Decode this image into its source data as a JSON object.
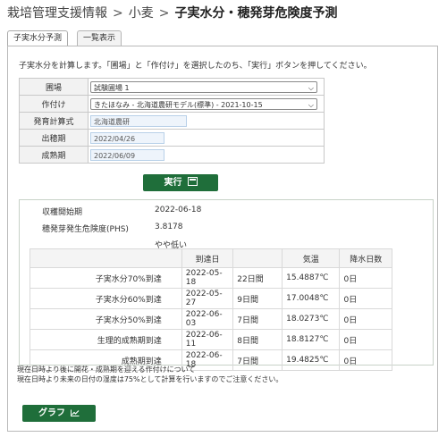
{
  "breadcrumb": {
    "items": [
      "栽培管理支援情報",
      "小麦"
    ],
    "separator": ">",
    "current": "子実水分・穂発芽危険度予測"
  },
  "tabs": [
    {
      "label": "子実水分予測",
      "active": true
    },
    {
      "label": "一覧表示",
      "active": false
    }
  ],
  "intro": "子実水分を計算します。「圃場」と「作付け」を選択したのち、「実行」ボタンを押してください。",
  "form": {
    "field_label": "圃場",
    "field_value": "試験圃場 1",
    "crop_label": "作付け",
    "crop_value": "きたほなみ - 北海道農研モデル(標準) - 2021-10-15",
    "model_label": "発育計算式",
    "model_value": "北海道農研",
    "heading_label": "出穂期",
    "heading_value": "2022/04/26",
    "maturity_label": "成熟期",
    "maturity_value": "2022/06/09"
  },
  "exec_label": "実行",
  "result": {
    "harvest_label": "収穫開始期",
    "harvest_value": "2022-06-18",
    "phs_label": "穂発芽発生危険度(PHS)",
    "phs_value": "3.8178",
    "phs_level": "やや低い"
  },
  "milestones": {
    "headers": [
      "",
      "到達日",
      "",
      "気温",
      "降水日数"
    ],
    "rows": [
      {
        "name": "子実水分70%到達",
        "date": "2022-05-18",
        "days": "22日間",
        "temp": "15.4887℃",
        "rain": "0日"
      },
      {
        "name": "子実水分60%到達",
        "date": "2022-05-27",
        "days": "9日間",
        "temp": "17.0048℃",
        "rain": "0日"
      },
      {
        "name": "子実水分50%到達",
        "date": "2022-06-03",
        "days": "7日間",
        "temp": "18.0273℃",
        "rain": "0日"
      },
      {
        "name": "生理的成熟期到達",
        "date": "2022-06-11",
        "days": "8日間",
        "temp": "18.8127℃",
        "rain": "0日"
      },
      {
        "name": "成熟期到達",
        "date": "2022-06-18",
        "days": "7日間",
        "temp": "19.4825℃",
        "rain": "0日"
      }
    ]
  },
  "notes": [
    "現在日時より後に開花・成熟期を迎える作付けについて",
    "現在日時より未来の日付の湿度は75%として計算を行いますのでご注意ください。"
  ],
  "graph_label": "グラフ",
  "colors": {
    "button_green": "#1f6e3a"
  }
}
